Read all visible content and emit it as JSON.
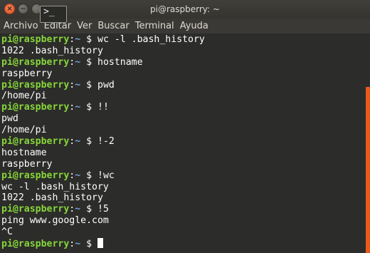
{
  "window": {
    "title": "pi@raspberry: ~",
    "close_glyph": "×",
    "minimize_glyph": "−",
    "app_icon_glyph": ">_"
  },
  "menu": {
    "items": [
      {
        "label": "Archivo"
      },
      {
        "label": "Editar"
      },
      {
        "label": "Ver"
      },
      {
        "label": "Buscar"
      },
      {
        "label": "Terminal"
      },
      {
        "label": "Ayuda"
      }
    ]
  },
  "prompt": {
    "host": "pi@raspberry",
    "colon": ":",
    "path": "~",
    "symbol": " $ "
  },
  "terminal_lines": [
    {
      "type": "prompt",
      "command": "wc -l .bash_history"
    },
    {
      "type": "output",
      "text": "1022 .bash_history"
    },
    {
      "type": "prompt",
      "command": "hostname"
    },
    {
      "type": "output",
      "text": "raspberry"
    },
    {
      "type": "prompt",
      "command": "pwd"
    },
    {
      "type": "output",
      "text": "/home/pi"
    },
    {
      "type": "prompt",
      "command": "!!"
    },
    {
      "type": "output",
      "text": "pwd"
    },
    {
      "type": "output",
      "text": "/home/pi"
    },
    {
      "type": "prompt",
      "command": "!-2"
    },
    {
      "type": "output",
      "text": "hostname"
    },
    {
      "type": "output",
      "text": "raspberry"
    },
    {
      "type": "prompt",
      "command": "!wc"
    },
    {
      "type": "output",
      "text": "wc -l .bash_history"
    },
    {
      "type": "output",
      "text": "1022 .bash_history"
    },
    {
      "type": "prompt",
      "command": "!5"
    },
    {
      "type": "output",
      "text": "ping www.google.com"
    },
    {
      "type": "output",
      "text": "^C"
    },
    {
      "type": "prompt",
      "command": "",
      "cursor": true
    }
  ],
  "colors": {
    "host": "#87d63a",
    "path": "#729fcf",
    "background": "#2c2c2a",
    "scrollbar": "#e95a1c",
    "close_button": "#e95420"
  },
  "icons": {
    "close": "close-icon",
    "minimize": "minimize-icon",
    "maximize": "maximize-icon",
    "app": "terminal-icon"
  }
}
